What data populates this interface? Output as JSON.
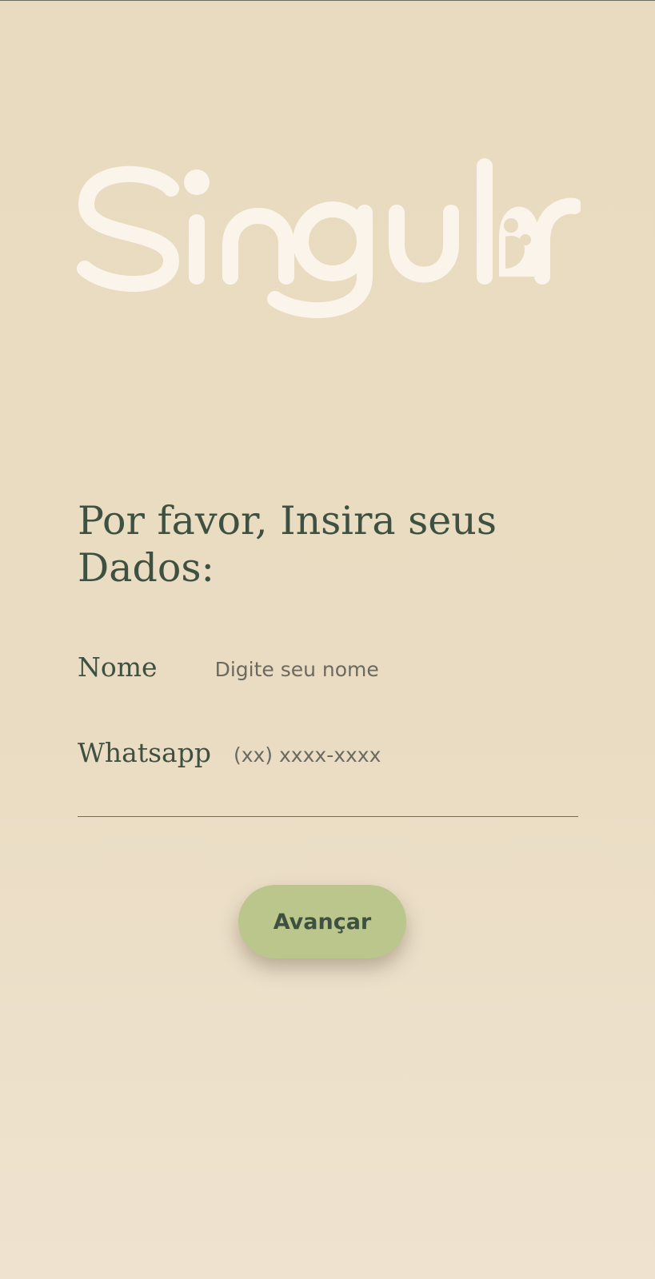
{
  "brand": {
    "logo_text": "Singular",
    "logo_color": "#faf4ea"
  },
  "form": {
    "title": "Por favor, Insira seus Dados:",
    "name_label": "Nome",
    "name_placeholder": "Digite seu nome",
    "whatsapp_label": "Whatsapp",
    "whatsapp_placeholder": "(xx) xxxx-xxxx"
  },
  "actions": {
    "next_label": "Avançar"
  },
  "colors": {
    "background": "#e9dbbf",
    "text": "#3e5140",
    "button": "#bac68c"
  }
}
